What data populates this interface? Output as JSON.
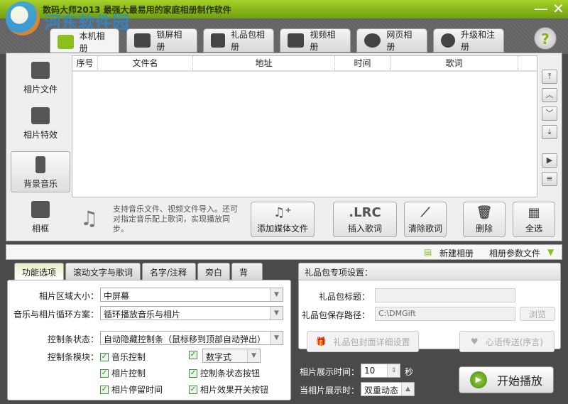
{
  "title": "数码大师2013    最强大最易用的家庭相册制作软件",
  "watermark": "河东软件园",
  "window_controls": {
    "minimize": "—",
    "close": "✕"
  },
  "tabs": [
    {
      "label": "本机相册",
      "icon": "photo-icon"
    },
    {
      "label": "锁屏相册",
      "icon": "monitor-icon"
    },
    {
      "label": "礼品包相册",
      "icon": "gift-icon"
    },
    {
      "label": "视频相册",
      "icon": "film-icon"
    },
    {
      "label": "网页相册",
      "icon": "ie-icon"
    },
    {
      "label": "升级和注册",
      "icon": "globe-icon"
    }
  ],
  "help": "?",
  "sidebar": [
    {
      "label": "相片文件",
      "icon": "camera-icon"
    },
    {
      "label": "相片特效",
      "icon": "effects-icon"
    },
    {
      "label": "背景音乐",
      "icon": "music-icon",
      "active": true
    },
    {
      "label": "相框",
      "icon": "frame-icon"
    }
  ],
  "list": {
    "columns": [
      "序号",
      "文件名",
      "地址",
      "时间",
      "歌词"
    ]
  },
  "right_buttons": {
    "top": "⤒",
    "up": "︿",
    "down": "﹀",
    "bottom": "⤓",
    "play": "▶",
    "doc": "≡"
  },
  "info_text": "支持音乐文件、视频文件导入。还可对指定音乐配上歌词，实现播放同步。",
  "toolbar": {
    "add_media": "添加媒体文件",
    "insert_lyrics": "插入歌词",
    "lrc_glyph": ".LRC",
    "clear_lyrics": "清除歌词",
    "delete": "删除",
    "select_all": "全选"
  },
  "strip": {
    "new_album": "新建相册",
    "album_params": "相册参数文件"
  },
  "bottom_tabs": [
    "功能选项",
    "滚动文字与歌词",
    "名字/注释",
    "旁白",
    "背景"
  ],
  "options": {
    "photo_area_label": "相片区域大小：",
    "photo_area_value": "中屏幕",
    "loop_label": "音乐与相片循环方案：",
    "loop_value": "循环播放音乐与相片",
    "ctrl_state_label": "控制条状态：",
    "ctrl_state_value": "自动隐藏控制条（鼠标移到顶部自动弹出）",
    "ctrl_module_label": "控制条模块：",
    "checks": [
      {
        "label": "音乐控制",
        "checked": true
      },
      {
        "label": "",
        "checked": true
      },
      {
        "label": "相片控制",
        "checked": true
      },
      {
        "label": "控制条状态按钮",
        "checked": true
      },
      {
        "label": "相片停留时间",
        "checked": true
      },
      {
        "label": "相片效果开关按钮",
        "checked": true
      }
    ],
    "number_style": "数字式"
  },
  "gift": {
    "header": "礼品包专项设置：",
    "title_label": "礼品包标题：",
    "title_value": "",
    "path_label": "礼品包保存路径：",
    "path_value": "C:\\DMGift",
    "browse": "浏览",
    "cover_settings": "礼品包封面详细设置",
    "message": "心语传送(序言)"
  },
  "display": {
    "time_label": "相片展示时间：",
    "time_value": "10",
    "time_unit": "秒",
    "when_label": "当相片展示时：",
    "when_value": "双重动态"
  },
  "start": "开始播放"
}
